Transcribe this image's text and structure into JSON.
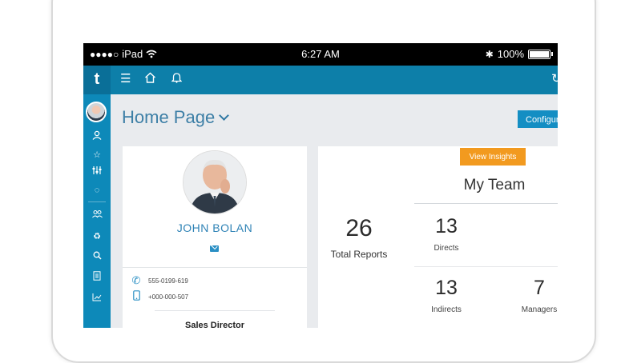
{
  "status_bar": {
    "carrier": "iPad",
    "time": "6:27 AM",
    "battery": "100%"
  },
  "sidebar": {
    "logo": "t",
    "items": [
      "user-icon",
      "star-icon",
      "sliders-icon",
      "refresh-icon",
      "group-icon",
      "recycle-icon",
      "search-icon",
      "document-icon",
      "chart-icon"
    ]
  },
  "appbar": {
    "icons": [
      "menu-icon",
      "home-icon",
      "bell-icon",
      "sync-icon"
    ]
  },
  "page": {
    "title": "Home Page",
    "configure_label": "Configure"
  },
  "profile": {
    "name": "JOHN BOLAN",
    "phone": "555-0199-619",
    "mobile": "+000-000-507",
    "role": "Sales Director"
  },
  "team": {
    "insights_label": "View Insights",
    "title": "My Team",
    "total_reports": "26",
    "total_reports_label": "Total Reports",
    "directs": "13",
    "directs_label": "Directs",
    "indirects": "13",
    "indirects_label": "Indirects",
    "managers": "7",
    "managers_label": "Managers"
  },
  "colors": {
    "sidebar": "#0d89b9",
    "appbar": "#0d7fa9",
    "accent": "#148ec3",
    "insights": "#f29a1f"
  }
}
